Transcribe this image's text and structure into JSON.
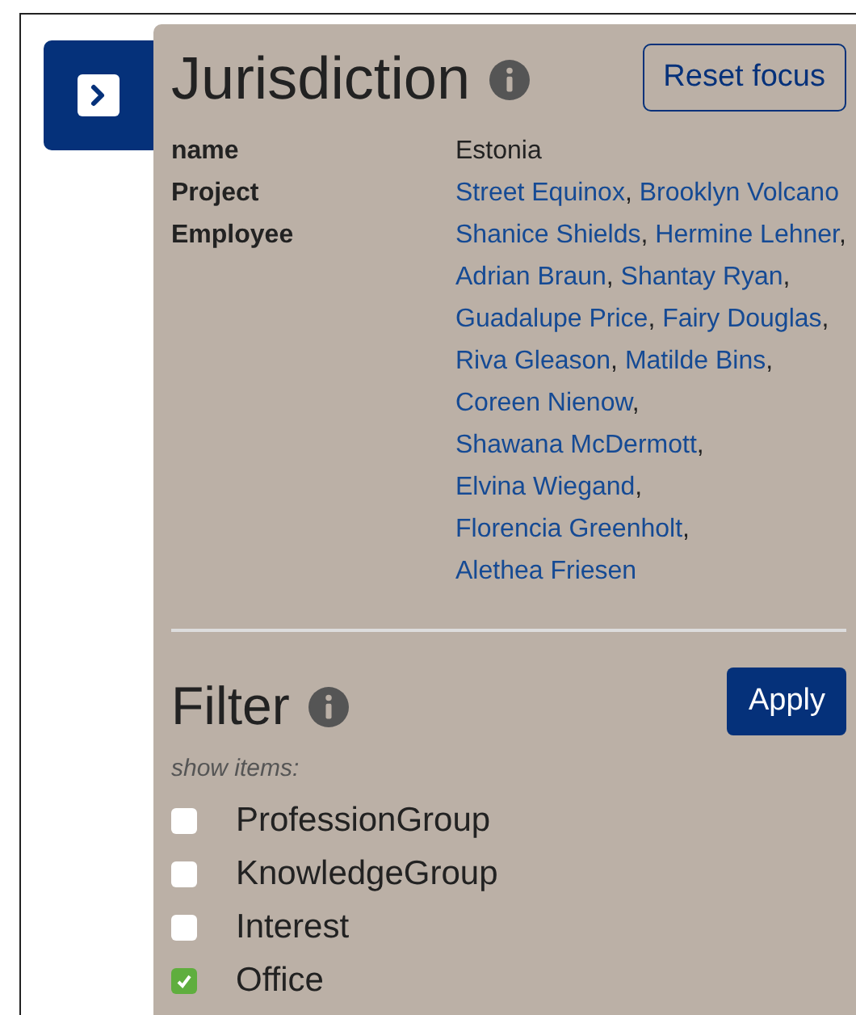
{
  "toggle_button": {
    "expanded": true
  },
  "jurisdiction": {
    "title": "Jurisdiction",
    "reset_button": "Reset focus",
    "properties": [
      {
        "label": "name",
        "kind": "text",
        "value": "Estonia"
      },
      {
        "label": "Project",
        "kind": "links",
        "separator": ", ",
        "links": [
          "Street Equinox",
          "Brooklyn Volcano"
        ]
      },
      {
        "label": "Employee",
        "kind": "links",
        "separator": ", ",
        "links": [
          "Shanice Shields",
          "Hermine Lehner",
          "Adrian Braun",
          "Shantay Ryan",
          "Guadalupe Price",
          "Fairy Douglas",
          "Riva Gleason",
          "Matilde Bins",
          "Coreen Nienow",
          "Shawana McDermott",
          "Elvina Wiegand",
          "Florencia Greenholt",
          "Alethea Friesen"
        ]
      }
    ]
  },
  "filter": {
    "title": "Filter",
    "apply_button": "Apply",
    "hint": "show items:",
    "options": [
      {
        "label": "ProfessionGroup",
        "checked": false
      },
      {
        "label": "KnowledgeGroup",
        "checked": false
      },
      {
        "label": "Interest",
        "checked": false
      },
      {
        "label": "Office",
        "checked": true
      }
    ]
  }
}
